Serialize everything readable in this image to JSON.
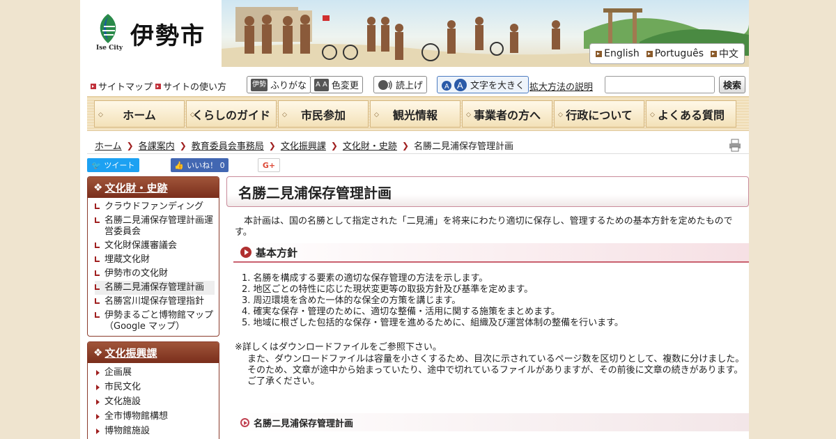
{
  "header": {
    "city_name": "伊勢市",
    "logo_text": "Ise City",
    "languages": [
      "English",
      "Português",
      "中文"
    ]
  },
  "util": {
    "sitemap": "サイトマップ",
    "howto": "サイトの使い方",
    "furigana_icon": "伊勢",
    "furigana": "ふりがな",
    "color_icon": "A A",
    "color": "色変更",
    "read": "読上げ",
    "zoom": "文字を大きく",
    "zoom_help": "拡大方法の説明",
    "search_button": "検索"
  },
  "nav": [
    "ホーム",
    "くらしのガイド",
    "市民参加",
    "観光情報",
    "事業者の方へ",
    "行政について",
    "よくある質問"
  ],
  "breadcrumb": [
    "ホーム",
    "各課案内",
    "教育委員会事務局",
    "文化振興課",
    "文化財・史跡",
    "名勝二見浦保存管理計画"
  ],
  "social": {
    "tweet": "ツイート",
    "like": "いいね！ 0",
    "gplus": "G+"
  },
  "sidebar1": {
    "title": "文化財・史跡",
    "items": [
      "クラウドファンディング",
      "名勝二見浦保存管理計画運営委員会",
      "文化財保護審議会",
      "埋蔵文化財",
      "伊勢市の文化財",
      "名勝二見浦保存管理計画",
      "名勝宮川堤保存管理指針",
      "伊勢まるごと博物館マップ（Google マップ）"
    ]
  },
  "sidebar2": {
    "title": "文化振興課",
    "items": [
      "企画展",
      "市民文化",
      "文化施設",
      "全市博物館構想",
      "博物館施設"
    ]
  },
  "main": {
    "title": "名勝二見浦保存管理計画",
    "intro": "本計画は、国の名勝として指定された「二見浦」を将来にわたり適切に保存し、管理するための基本方針を定めたものです。",
    "policy_heading": "基本方針",
    "policies": [
      "名勝を構成する要素の適切な保存管理の方法を示します。",
      "地区ごとの特性に応じた現状変更等の取扱方針及び基準を定めます。",
      "周辺環境を含めた一体的な保全の方策を講じます。",
      "確実な保存・管理のために、適切な整備・活用に関する施策をまとめます。",
      "地域に根ざした包括的な保存・管理を進めるために、組織及び運営体制の整備を行います。"
    ],
    "note": "※詳しくはダウンロードファイルをご参照下さい。",
    "note2": "また、ダウンロードファイルは容量を小さくするため、目次に示されているページ数を区切りとして、複数に分けました。そのため、文章が途中から始まっていたり、途中で切れているファイルがありますが、その前後に文章の続きがあります。ご了承ください。",
    "sub_heading": "名勝二見浦保存管理計画"
  }
}
